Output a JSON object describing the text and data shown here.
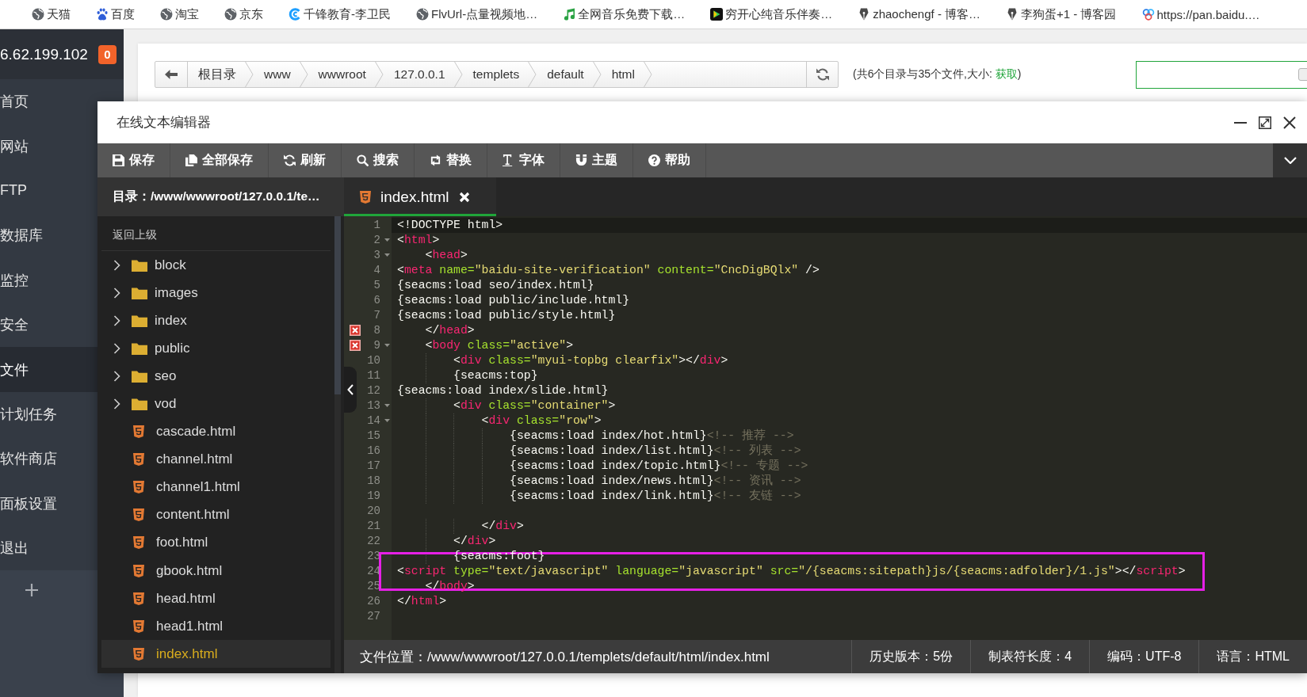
{
  "bookmarks": [
    {
      "label": "天猫"
    },
    {
      "label": "百度"
    },
    {
      "label": "淘宝"
    },
    {
      "label": "京东"
    },
    {
      "label": "千锋教育-李卫民"
    },
    {
      "label": "FlvUrl-点量视频地…"
    },
    {
      "label": "全网音乐免费下载…"
    },
    {
      "label": "穷开心纯音乐伴奏…"
    },
    {
      "label": "zhaochengf - 博客…"
    },
    {
      "label": "李狗蛋+1 - 博客园"
    },
    {
      "label": "https://pan.baidu.…"
    }
  ],
  "sidebar": {
    "server": "6.62.199.102",
    "badge": "0",
    "items": [
      {
        "label": "首页",
        "selected": false
      },
      {
        "label": "网站",
        "selected": false
      },
      {
        "label": "FTP",
        "selected": false
      },
      {
        "label": "数据库",
        "selected": false
      },
      {
        "label": "监控",
        "selected": false
      },
      {
        "label": "安全",
        "selected": false
      },
      {
        "label": "文件",
        "selected": true
      },
      {
        "label": "计划任务",
        "selected": false
      },
      {
        "label": "软件商店",
        "selected": false
      },
      {
        "label": "面板设置",
        "selected": false
      },
      {
        "label": "退出",
        "selected": false
      }
    ]
  },
  "file_manager": {
    "crumbs": [
      "根目录",
      "www",
      "wwwroot",
      "127.0.0.1",
      "templets",
      "default",
      "html"
    ],
    "summary": {
      "text": "(共6个目录与35个文件,大小: ",
      "link": "获取",
      "end": ")"
    }
  },
  "editor": {
    "title": "在线文本编辑器",
    "toolbar": [
      {
        "label": "保存"
      },
      {
        "label": "全部保存"
      },
      {
        "label": "刷新"
      },
      {
        "label": "搜索"
      },
      {
        "label": "替换"
      },
      {
        "label": "字体"
      },
      {
        "label": "主题"
      },
      {
        "label": "帮助"
      }
    ],
    "directory": "目录：/www/wwwroot/127.0.0.1/te…",
    "tabs": [
      {
        "label": "index.html",
        "selected": true
      }
    ],
    "tree": {
      "up": "返回上级",
      "items": [
        {
          "kind": "folder",
          "name": "block",
          "selected": false
        },
        {
          "kind": "folder",
          "name": "images",
          "selected": false
        },
        {
          "kind": "folder",
          "name": "index",
          "selected": false
        },
        {
          "kind": "folder",
          "name": "public",
          "selected": false
        },
        {
          "kind": "folder",
          "name": "seo",
          "selected": false
        },
        {
          "kind": "folder",
          "name": "vod",
          "selected": false
        },
        {
          "kind": "file",
          "name": "cascade.html",
          "selected": false
        },
        {
          "kind": "file",
          "name": "channel.html",
          "selected": false
        },
        {
          "kind": "file",
          "name": "channel1.html",
          "selected": false
        },
        {
          "kind": "file",
          "name": "content.html",
          "selected": false
        },
        {
          "kind": "file",
          "name": "foot.html",
          "selected": false
        },
        {
          "kind": "file",
          "name": "gbook.html",
          "selected": false
        },
        {
          "kind": "file",
          "name": "head.html",
          "selected": false
        },
        {
          "kind": "file",
          "name": "head1.html",
          "selected": false
        },
        {
          "kind": "file",
          "name": "index.html",
          "selected": true
        }
      ]
    },
    "lines": [
      {
        "number": "1",
        "fold": false,
        "error": false,
        "active": true,
        "highlighted": false,
        "tokens": [
          {
            "kind": "plain",
            "text": "<!DOCTYPE html>"
          }
        ]
      },
      {
        "number": "2",
        "fold": true,
        "error": false,
        "active": false,
        "highlighted": false,
        "tokens": [
          {
            "kind": "plain",
            "text": "<"
          },
          {
            "kind": "tag",
            "text": "html"
          },
          {
            "kind": "plain",
            "text": ">"
          }
        ]
      },
      {
        "number": "3",
        "fold": true,
        "error": false,
        "active": false,
        "highlighted": false,
        "tokens": [
          {
            "kind": "plain",
            "text": "    <"
          },
          {
            "kind": "tag",
            "text": "head"
          },
          {
            "kind": "plain",
            "text": ">"
          }
        ]
      },
      {
        "number": "4",
        "fold": false,
        "error": false,
        "active": false,
        "highlighted": false,
        "tokens": [
          {
            "kind": "plain",
            "text": "<"
          },
          {
            "kind": "tag",
            "text": "meta"
          },
          {
            "kind": "attr",
            "text": " name="
          },
          {
            "kind": "string",
            "text": "\"baidu-site-verification\""
          },
          {
            "kind": "attr",
            "text": " content="
          },
          {
            "kind": "string",
            "text": "\"CncDigBQlx\""
          },
          {
            "kind": "plain",
            "text": " />"
          }
        ]
      },
      {
        "number": "5",
        "fold": false,
        "error": false,
        "active": false,
        "highlighted": false,
        "tokens": [
          {
            "kind": "plain",
            "text": "{seacms:load seo/index.html}"
          }
        ]
      },
      {
        "number": "6",
        "fold": false,
        "error": false,
        "active": false,
        "highlighted": false,
        "tokens": [
          {
            "kind": "plain",
            "text": "{seacms:load public/include.html}"
          }
        ]
      },
      {
        "number": "7",
        "fold": false,
        "error": false,
        "active": false,
        "highlighted": false,
        "tokens": [
          {
            "kind": "plain",
            "text": "{seacms:load public/style.html}"
          }
        ]
      },
      {
        "number": "8",
        "fold": false,
        "error": true,
        "active": false,
        "highlighted": false,
        "tokens": [
          {
            "kind": "plain",
            "text": "    </"
          },
          {
            "kind": "tag",
            "text": "head"
          },
          {
            "kind": "plain",
            "text": ">"
          }
        ]
      },
      {
        "number": "9",
        "fold": true,
        "error": true,
        "active": false,
        "highlighted": false,
        "tokens": [
          {
            "kind": "plain",
            "text": "    <"
          },
          {
            "kind": "tag",
            "text": "body"
          },
          {
            "kind": "attr",
            "text": " class="
          },
          {
            "kind": "string",
            "text": "\"active\""
          },
          {
            "kind": "plain",
            "text": ">"
          }
        ]
      },
      {
        "number": "10",
        "fold": false,
        "error": false,
        "active": false,
        "highlighted": false,
        "tokens": [
          {
            "kind": "plain",
            "text": "        <"
          },
          {
            "kind": "tag",
            "text": "div"
          },
          {
            "kind": "attr",
            "text": " class="
          },
          {
            "kind": "string",
            "text": "\"myui-topbg clearfix\""
          },
          {
            "kind": "plain",
            "text": "></"
          },
          {
            "kind": "tag",
            "text": "div"
          },
          {
            "kind": "plain",
            "text": ">"
          }
        ]
      },
      {
        "number": "11",
        "fold": false,
        "error": false,
        "active": false,
        "highlighted": false,
        "tokens": [
          {
            "kind": "plain",
            "text": "        {seacms:top}"
          }
        ]
      },
      {
        "number": "12",
        "fold": false,
        "error": false,
        "active": false,
        "highlighted": false,
        "tokens": [
          {
            "kind": "plain",
            "text": "{seacms:load index/slide.html}"
          }
        ]
      },
      {
        "number": "13",
        "fold": true,
        "error": false,
        "active": false,
        "highlighted": false,
        "tokens": [
          {
            "kind": "plain",
            "text": "        <"
          },
          {
            "kind": "tag",
            "text": "div"
          },
          {
            "kind": "attr",
            "text": " class="
          },
          {
            "kind": "string",
            "text": "\"container\""
          },
          {
            "kind": "plain",
            "text": ">"
          }
        ]
      },
      {
        "number": "14",
        "fold": true,
        "error": false,
        "active": false,
        "highlighted": false,
        "tokens": [
          {
            "kind": "plain",
            "text": "            <"
          },
          {
            "kind": "tag",
            "text": "div"
          },
          {
            "kind": "attr",
            "text": " class="
          },
          {
            "kind": "string",
            "text": "\"row\""
          },
          {
            "kind": "plain",
            "text": ">"
          }
        ]
      },
      {
        "number": "15",
        "fold": false,
        "error": false,
        "active": false,
        "highlighted": false,
        "tokens": [
          {
            "kind": "plain",
            "text": "                {seacms:load index/hot.html}"
          },
          {
            "kind": "comment",
            "text": "<!-- 推荐 -->"
          }
        ]
      },
      {
        "number": "16",
        "fold": false,
        "error": false,
        "active": false,
        "highlighted": false,
        "tokens": [
          {
            "kind": "plain",
            "text": "                {seacms:load index/list.html}"
          },
          {
            "kind": "comment",
            "text": "<!-- 列表 -->"
          }
        ]
      },
      {
        "number": "17",
        "fold": false,
        "error": false,
        "active": false,
        "highlighted": false,
        "tokens": [
          {
            "kind": "plain",
            "text": "                {seacms:load index/topic.html}"
          },
          {
            "kind": "comment",
            "text": "<!-- 专题 -->"
          }
        ]
      },
      {
        "number": "18",
        "fold": false,
        "error": false,
        "active": false,
        "highlighted": false,
        "tokens": [
          {
            "kind": "plain",
            "text": "                {seacms:load index/news.html}"
          },
          {
            "kind": "comment",
            "text": "<!-- 资讯 -->"
          }
        ]
      },
      {
        "number": "19",
        "fold": false,
        "error": false,
        "active": false,
        "highlighted": false,
        "tokens": [
          {
            "kind": "plain",
            "text": "                {seacms:load index/link.html}"
          },
          {
            "kind": "comment",
            "text": "<!-- 友链 -->"
          }
        ]
      },
      {
        "number": "20",
        "fold": false,
        "error": false,
        "active": false,
        "highlighted": false
      },
      {
        "number": "21",
        "fold": false,
        "error": false,
        "active": false,
        "highlighted": false,
        "tokens": [
          {
            "kind": "plain",
            "text": "            </"
          },
          {
            "kind": "tag",
            "text": "div"
          },
          {
            "kind": "plain",
            "text": ">"
          }
        ]
      },
      {
        "number": "22",
        "fold": false,
        "error": false,
        "active": false,
        "highlighted": false,
        "tokens": [
          {
            "kind": "plain",
            "text": "        </"
          },
          {
            "kind": "tag",
            "text": "div"
          },
          {
            "kind": "plain",
            "text": ">"
          }
        ]
      },
      {
        "number": "23",
        "fold": false,
        "error": false,
        "active": false,
        "highlighted": false,
        "tokens": [
          {
            "kind": "plain",
            "text": "        {seacms:foot}"
          }
        ]
      },
      {
        "number": "24",
        "fold": false,
        "error": false,
        "active": false,
        "highlighted": true,
        "tokens": [
          {
            "kind": "plain",
            "text": "<"
          },
          {
            "kind": "tag",
            "text": "script"
          },
          {
            "kind": "attr",
            "text": " type="
          },
          {
            "kind": "string",
            "text": "\"text/javascript\""
          },
          {
            "kind": "attr",
            "text": " language="
          },
          {
            "kind": "string",
            "text": "\"javascript\""
          },
          {
            "kind": "attr",
            "text": " src="
          },
          {
            "kind": "string",
            "text": "\"/{seacms:sitepath}js/{seacms:adfolder}/1.js\""
          },
          {
            "kind": "plain",
            "text": "></"
          },
          {
            "kind": "tag",
            "text": "script"
          },
          {
            "kind": "plain",
            "text": ">"
          }
        ]
      },
      {
        "number": "25",
        "fold": false,
        "error": false,
        "active": false,
        "highlighted": false,
        "tokens": [
          {
            "kind": "plain",
            "text": "    </"
          },
          {
            "kind": "tag",
            "text": "body"
          },
          {
            "kind": "plain",
            "text": ">"
          }
        ]
      },
      {
        "number": "26",
        "fold": false,
        "error": false,
        "active": false,
        "highlighted": false,
        "tokens": [
          {
            "kind": "plain",
            "text": "</"
          },
          {
            "kind": "tag",
            "text": "html"
          },
          {
            "kind": "plain",
            "text": ">"
          }
        ]
      },
      {
        "number": "27",
        "fold": false,
        "error": false,
        "active": false,
        "highlighted": false
      }
    ],
    "status_bar": {
      "path": "文件位置：/www/wwwroot/127.0.0.1/templets/default/html/index.html",
      "items": [
        "历史版本：5份",
        "制表符长度：4",
        "编码：UTF-8",
        "语言：HTML"
      ]
    }
  }
}
